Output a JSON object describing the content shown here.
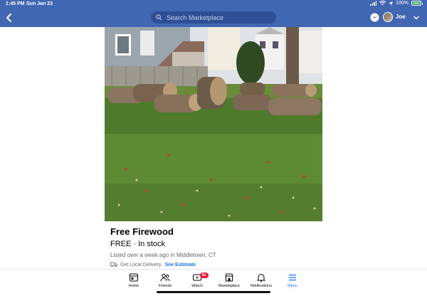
{
  "status": {
    "time": "1:45 PM",
    "date": "Sun Jan 23",
    "battery": "100%"
  },
  "nav": {
    "search_placeholder": "Search Marketplace",
    "username": "Joe"
  },
  "listing": {
    "title": "Free Firewood",
    "price_line": "FREE · In stock",
    "listed": "Listed over a week ago in Middletown, CT",
    "delivery_text": "Get Local Delivery.",
    "delivery_link": "See Estimate"
  },
  "tabs": [
    {
      "label": "Home",
      "icon": "home-icon"
    },
    {
      "label": "Friends",
      "icon": "friends-icon"
    },
    {
      "label": "Watch",
      "icon": "watch-icon",
      "badge": "9+"
    },
    {
      "label": "Marketplace",
      "icon": "marketplace-icon"
    },
    {
      "label": "Notifications",
      "icon": "bell-icon"
    },
    {
      "label": "Menu",
      "icon": "menu-icon",
      "active": true
    }
  ],
  "colors": {
    "brand": "#4267b2",
    "link": "#1b74e4",
    "active_tab": "#1877f2",
    "badge": "#e41e3f"
  }
}
